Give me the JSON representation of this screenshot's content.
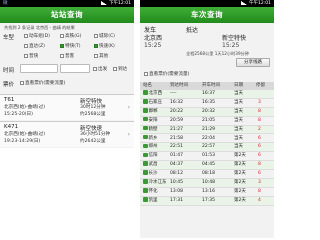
{
  "left": {
    "status": {
      "left": "微",
      "right": "下午12:01"
    },
    "title": "站站查询",
    "summary": "共找到 2 条记录 北京西 - 曲靖 的结果",
    "train_type": {
      "label": "车型",
      "options": [
        {
          "label": "动车组(D)",
          "checked": false
        },
        {
          "label": "高铁(G)",
          "checked": false
        },
        {
          "label": "城际(C)",
          "checked": false
        },
        {
          "label": "直达(Z)",
          "checked": false
        },
        {
          "label": "特快(T)",
          "checked": true
        },
        {
          "label": "快速(K)",
          "checked": true
        },
        {
          "label": "普快",
          "checked": false
        },
        {
          "label": "普客",
          "checked": false
        },
        {
          "label": "其他",
          "checked": false
        }
      ]
    },
    "time": {
      "label": "时间",
      "options": [
        {
          "label": "出发",
          "checked": false
        },
        {
          "label": "到达",
          "checked": false
        }
      ]
    },
    "fare": {
      "label": "票价",
      "checkbox": "直看票价(需要流量)",
      "checked": false
    },
    "results": [
      {
        "train": "T61",
        "train_type": "新空特快",
        "route": "北京西(始)-曲靖(过)",
        "duration": "30时12分钟",
        "time": "15:25-20(日)",
        "distance": "约2568公里"
      },
      {
        "train": "K471",
        "train_type": "新空快速",
        "route": "北京西(始)-曲靖(过)",
        "duration": "36小时51分钟",
        "time": "19:23-14:29(日)",
        "distance": "约2642公里"
      }
    ]
  },
  "right": {
    "status": {
      "left": "",
      "right": "午午12:01"
    },
    "title": "车次查询",
    "depart": {
      "label": "发车",
      "value": "北京西",
      "time": "15:25"
    },
    "arrive": {
      "label": "抵达",
      "value": "新空特快",
      "time": "15:25"
    },
    "travel_note": "全程2568公里 1天12小时39分钟",
    "share_button": "分享线路",
    "fare_checkbox": "直看票价(需要流量)",
    "columns": [
      "站名",
      "到达时间",
      "开车时间",
      "日期",
      "停留"
    ],
    "rows": [
      {
        "station": "北京西",
        "arrive": "----",
        "depart": "16:37",
        "day": "当天",
        "stop": ""
      },
      {
        "station": "石家庄",
        "arrive": "16:32",
        "depart": "16:35",
        "day": "当天",
        "stop": "3"
      },
      {
        "station": "邯郸",
        "arrive": "20:22",
        "depart": "20:32",
        "day": "当天",
        "stop": "8"
      },
      {
        "station": "安阳",
        "arrive": "20:59",
        "depart": "21:05",
        "day": "当天",
        "stop": "8"
      },
      {
        "station": "鹤壁",
        "arrive": "21:27",
        "depart": "21:29",
        "day": "当天",
        "stop": "2"
      },
      {
        "station": "新乡",
        "arrive": "21:58",
        "depart": "22:04",
        "day": "当天",
        "stop": "6"
      },
      {
        "station": "郑州",
        "arrive": "22:51",
        "depart": "22:57",
        "day": "当天",
        "stop": "6"
      },
      {
        "station": "信阳",
        "arrive": "01:47",
        "depart": "01:53",
        "day": "第2天",
        "stop": "6"
      },
      {
        "station": "武昌",
        "arrive": "04:37",
        "depart": "04:45",
        "day": "第2天",
        "stop": "8"
      },
      {
        "station": "长沙",
        "arrive": "08:12",
        "depart": "08:18",
        "day": "第2天",
        "stop": "6"
      },
      {
        "station": "冷水江东",
        "arrive": "10:45",
        "depart": "10:48",
        "day": "第2天",
        "stop": "3"
      },
      {
        "station": "怀化",
        "arrive": "13:08",
        "depart": "13:16",
        "day": "第2天",
        "stop": "8"
      },
      {
        "station": "凯里",
        "arrive": "17:31",
        "depart": "17:35",
        "day": "第2天",
        "stop": "4"
      }
    ]
  },
  "colors": {
    "title_bar": "#2f9c2a",
    "stripe": "#eaf3e8",
    "accent": "#3a9a34"
  }
}
